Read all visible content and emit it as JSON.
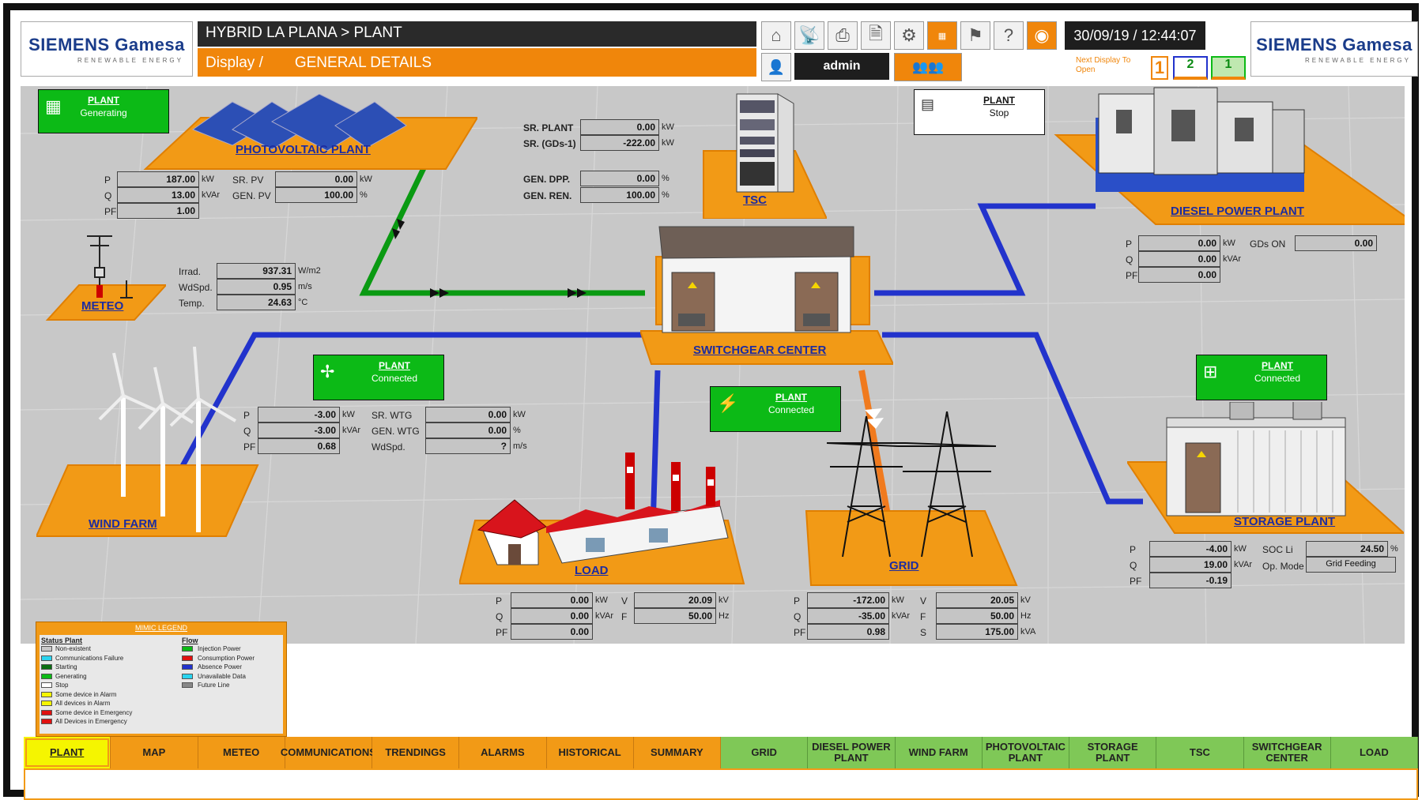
{
  "header": {
    "brand_left": "SIEMENS Gamesa",
    "brand_sub": "RENEWABLE ENERGY",
    "title": "HYBRID LA PLANA > PLANT",
    "display_prefix": "Display /",
    "display_name": "GENERAL DETAILS",
    "datetime": "30/09/19  /  12:44:07",
    "user": "admin",
    "next_display_label": "Next Display To Open",
    "screen_buttons": [
      "1",
      "2",
      "1"
    ],
    "toolbar_icons": [
      "home-icon",
      "antenna-icon",
      "printer-icon",
      "report-icon",
      "gears-icon",
      "summary-icon",
      "flag-uk-icon",
      "help-icon",
      "power-icon"
    ]
  },
  "photovoltaic": {
    "label": "PHOTOVOLTAIC PLANT",
    "status_title": "PLANT",
    "status": "Generating",
    "p_label": "P",
    "p": "187.00",
    "p_unit": "kW",
    "q_label": "Q",
    "q": "13.00",
    "q_unit": "kVAr",
    "pf_label": "PF",
    "pf": "1.00",
    "sr_label": "SR. PV",
    "sr": "0.00",
    "sr_unit": "kW",
    "gen_label": "GEN. PV",
    "gen": "100.00",
    "gen_unit": "%"
  },
  "plant_totals": {
    "sr_plant_label": "SR. PLANT",
    "sr_plant": "0.00",
    "sr_plant_unit": "kW",
    "sr_gds_label": "SR. (GDs-1)",
    "sr_gds": "-222.00",
    "sr_gds_unit": "kW",
    "gen_dpp_label": "GEN. DPP.",
    "gen_dpp": "0.00",
    "gen_dpp_unit": "%",
    "gen_ren_label": "GEN. REN.",
    "gen_ren": "100.00",
    "gen_ren_unit": "%"
  },
  "tsc": {
    "label": "TSC"
  },
  "diesel": {
    "label": "DIESEL POWER PLANT",
    "status_title": "PLANT",
    "status": "Stop",
    "p_label": "P",
    "p": "0.00",
    "p_unit": "kW",
    "q_label": "Q",
    "q": "0.00",
    "q_unit": "kVAr",
    "pf_label": "PF",
    "pf": "0.00",
    "gds_label": "GDs ON",
    "gds": "0.00"
  },
  "meteo": {
    "label": "METEO",
    "irrad_label": "Irrad.",
    "irrad": "937.31",
    "irrad_unit": "W/m2",
    "wdspd_label": "WdSpd.",
    "wdspd": "0.95",
    "wdspd_unit": "m/s",
    "temp_label": "Temp.",
    "temp": "24.63",
    "temp_unit": "°C"
  },
  "switchgear": {
    "label": "SWITCHGEAR CENTER"
  },
  "wind": {
    "label": "WIND FARM",
    "status_title": "PLANT",
    "status": "Connected",
    "p_label": "P",
    "p": "-3.00",
    "p_unit": "kW",
    "q_label": "Q",
    "q": "-3.00",
    "q_unit": "kVAr",
    "pf_label": "PF",
    "pf": "0.68",
    "sr_label": "SR. WTG",
    "sr": "0.00",
    "sr_unit": "kW",
    "gen_label": "GEN. WTG",
    "gen": "0.00",
    "gen_unit": "%",
    "wdspd_label": "WdSpd.",
    "wdspd": "?",
    "wdspd_unit": "m/s"
  },
  "grid": {
    "label": "GRID",
    "status_title": "PLANT",
    "status": "Connected",
    "p_label": "P",
    "p": "-172.00",
    "p_unit": "kW",
    "q_label": "Q",
    "q": "-35.00",
    "q_unit": "kVAr",
    "pf_label": "PF",
    "pf": "0.98",
    "v_label": "V",
    "v": "20.05",
    "v_unit": "kV",
    "f_label": "F",
    "f": "50.00",
    "f_unit": "Hz",
    "s_label": "S",
    "s": "175.00",
    "s_unit": "kVA"
  },
  "storage": {
    "label": "STORAGE PLANT",
    "status_title": "PLANT",
    "status": "Connected",
    "p_label": "P",
    "p": "-4.00",
    "p_unit": "kW",
    "q_label": "Q",
    "q": "19.00",
    "q_unit": "kVAr",
    "pf_label": "PF",
    "pf": "-0.19",
    "soc_label": "SOC Li",
    "soc": "24.50",
    "soc_unit": "%",
    "opmode_label": "Op. Mode",
    "opmode": "Grid Feeding"
  },
  "load": {
    "label": "LOAD",
    "p_label": "P",
    "p": "0.00",
    "p_unit": "kW",
    "q_label": "Q",
    "q": "0.00",
    "q_unit": "kVAr",
    "pf_label": "PF",
    "pf": "0.00",
    "v_label": "V",
    "v": "20.09",
    "v_unit": "kV",
    "f_label": "F",
    "f": "50.00",
    "f_unit": "Hz"
  },
  "legend": {
    "title": "MIMIC LEGEND",
    "status_title": "Status Plant",
    "status_items": [
      {
        "label": "Non-existent",
        "color": "#c8c8c8"
      },
      {
        "label": "Communications Failure",
        "color": "#2ad4f0"
      },
      {
        "label": "Starting",
        "color": "#0a6e12"
      },
      {
        "label": "Generating",
        "color": "#0cba16"
      },
      {
        "label": "Stop",
        "color": "#ffffff"
      },
      {
        "label": "Some device in Alarm",
        "color": "#f5f500"
      },
      {
        "label": "All devices in Alarm",
        "color": "#f5f500"
      },
      {
        "label": "Some device in Emergency",
        "color": "#e01010"
      },
      {
        "label": "All Devices in Emergency",
        "color": "#e01010"
      }
    ],
    "flow_title": "Flow",
    "flow_items": [
      {
        "label": "Injection Power",
        "color": "#0cba16"
      },
      {
        "label": "Consumption Power",
        "color": "#e01010"
      },
      {
        "label": "Absence Power",
        "color": "#2233cc"
      },
      {
        "label": "Unavailable Data",
        "color": "#2ad4f0"
      },
      {
        "label": "Future Line",
        "color": "#888888"
      }
    ]
  },
  "nav": {
    "orange": [
      "PLANT",
      "MAP",
      "METEO",
      "COMMUNICATIONS",
      "TRENDINGS",
      "ALARMS",
      "HISTORICAL",
      "SUMMARY"
    ],
    "green": [
      "GRID",
      "DIESEL POWER PLANT",
      "WIND FARM",
      "PHOTOVOLTAIC PLANT",
      "STORAGE PLANT",
      "TSC",
      "SWITCHGEAR CENTER",
      "LOAD"
    ],
    "selected": "PLANT"
  },
  "colors": {
    "injection": "#0cba16",
    "absence": "#2233cc",
    "consumption": "#f07a1e",
    "platform": "#f29a16"
  }
}
